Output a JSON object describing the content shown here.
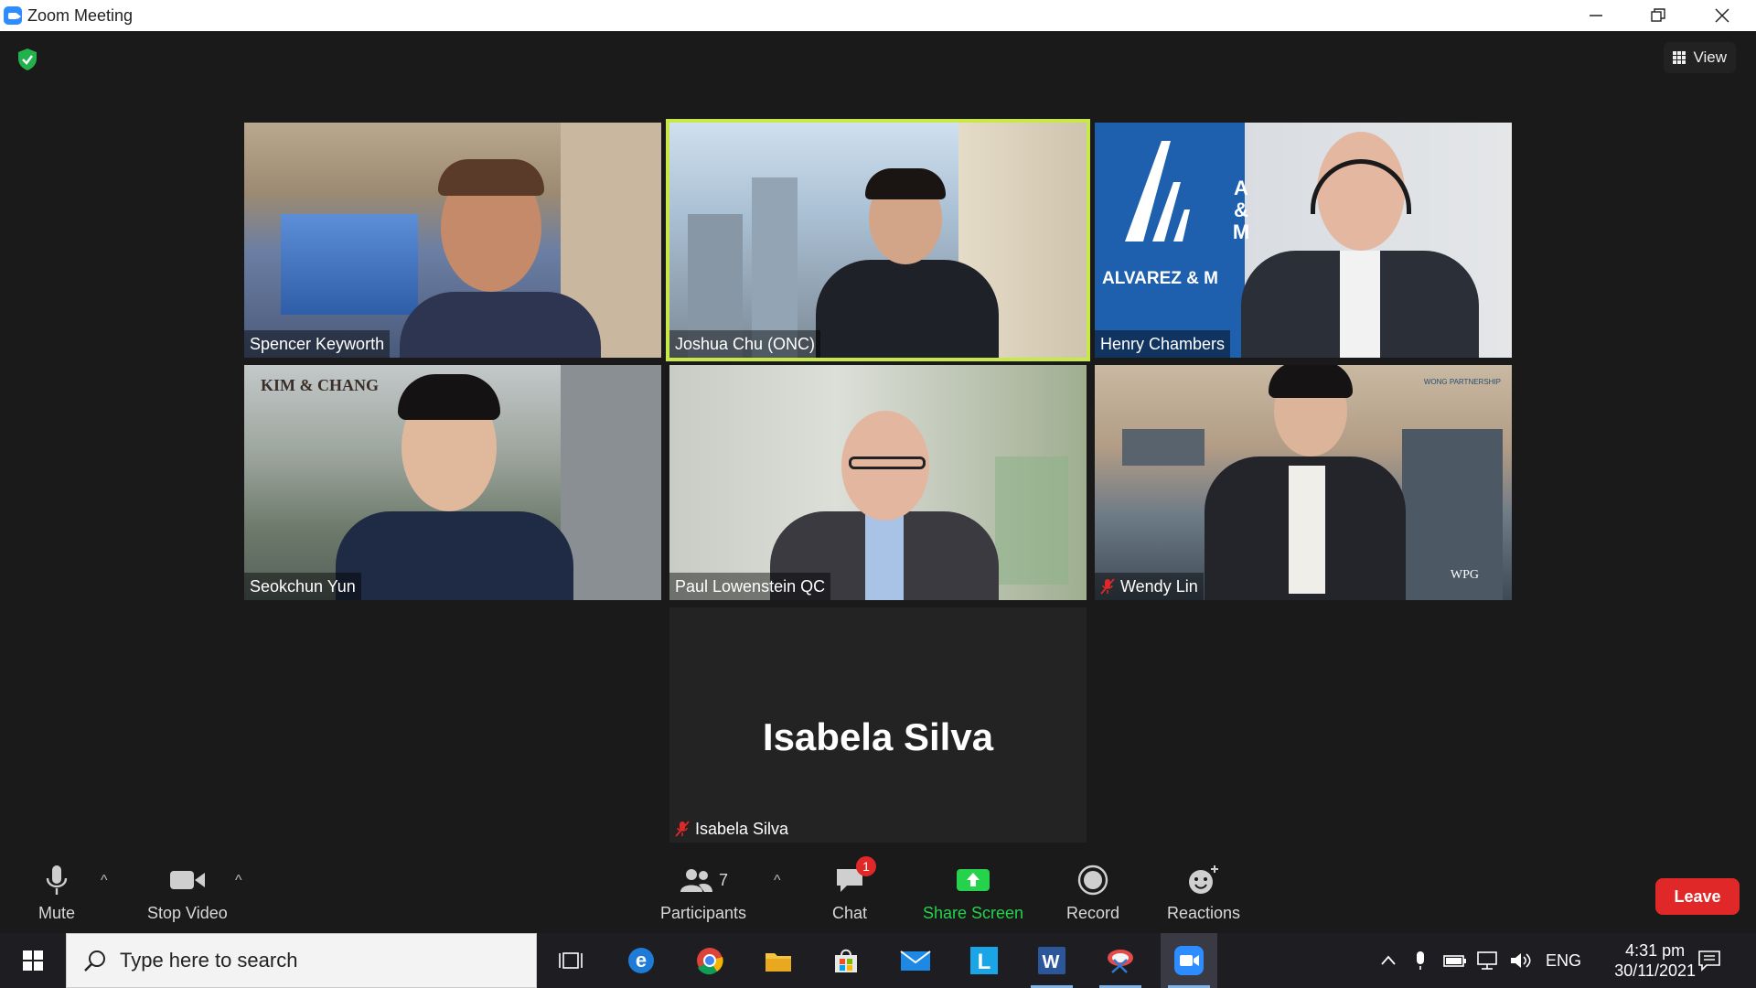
{
  "window": {
    "title": "Zoom Meeting"
  },
  "header": {
    "view_label": "View"
  },
  "tiles": [
    {
      "name": "Spencer Keyworth",
      "muted": false
    },
    {
      "name": "Joshua Chu (ONC)",
      "muted": false,
      "active_speaker": true
    },
    {
      "name": "Henry Chambers",
      "muted": false,
      "logo_text": "ALVAREZ & M",
      "logo_mark": "A & M"
    },
    {
      "name": "Seokchun Yun",
      "muted": false,
      "logo_text": "KIM & CHANG"
    },
    {
      "name": "Paul Lowenstein QC",
      "muted": false
    },
    {
      "name": "Wendy Lin",
      "muted": true,
      "logo_text": "WONG PARTNERSHIP",
      "logo_small": "WPG"
    },
    {
      "name": "Isabela Silva",
      "muted": true,
      "video_off": true,
      "big_name": "Isabela Silva"
    }
  ],
  "toolbar": {
    "mute_label": "Mute",
    "video_label": "Stop Video",
    "participants_label": "Participants",
    "participants_count": "7",
    "chat_label": "Chat",
    "chat_badge": "1",
    "share_label": "Share Screen",
    "record_label": "Record",
    "reactions_label": "Reactions",
    "leave_label": "Leave"
  },
  "taskbar": {
    "search_placeholder": "Type here to search",
    "language": "ENG",
    "time": "4:31 pm",
    "date": "30/11/2021"
  },
  "colors": {
    "accent_share": "#26d14b",
    "active_speaker": "#c8e84a",
    "leave": "#e02828",
    "muted_mic": "#e02828"
  }
}
